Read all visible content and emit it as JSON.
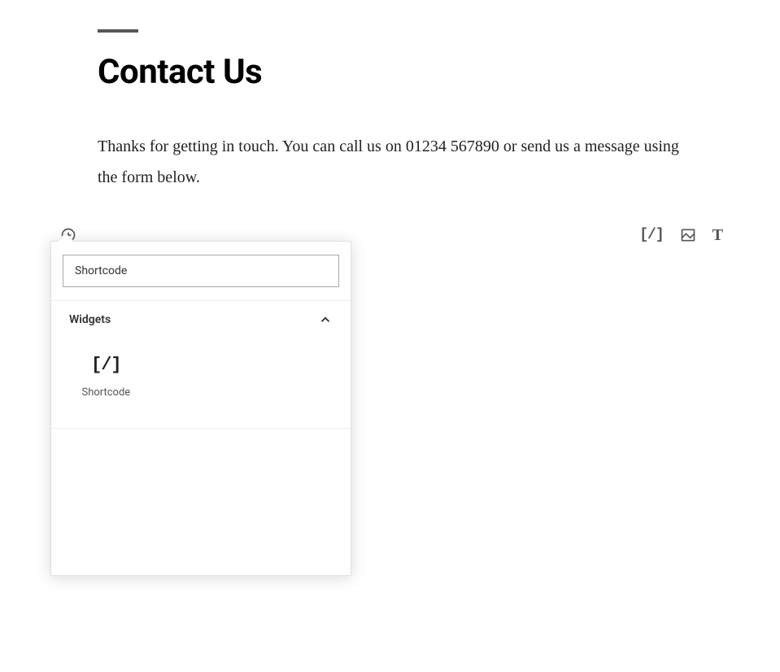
{
  "page": {
    "title": "Contact Us",
    "intro": "Thanks for getting in touch. You can call us on 01234 567890 or send us a message using the form below."
  },
  "editor": {
    "quick_icons": {
      "shortcode_glyph": "[/]",
      "text_glyph": "T"
    }
  },
  "block_inserter": {
    "search_value": "Shortcode",
    "section_title": "Widgets",
    "items": [
      {
        "icon_glyph": "[/]",
        "label": "Shortcode"
      }
    ]
  }
}
